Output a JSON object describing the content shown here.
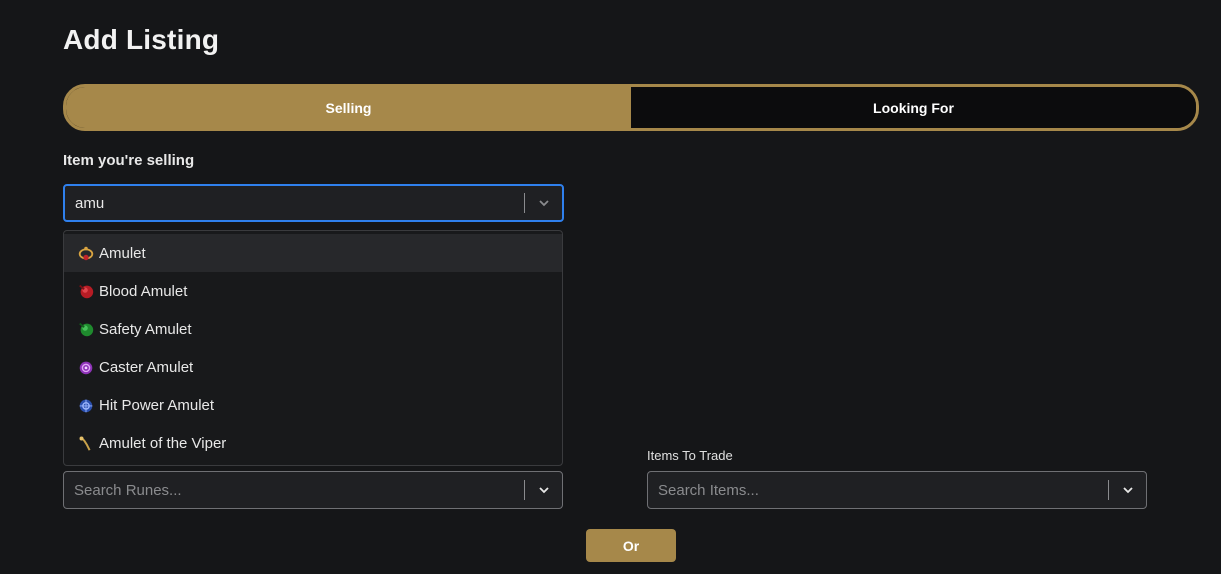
{
  "page": {
    "title": "Add Listing"
  },
  "mode_toggle": {
    "selling": "Selling",
    "looking_for": "Looking For",
    "active": "selling"
  },
  "item_selling": {
    "label": "Item you're selling",
    "value": "amu",
    "options": [
      {
        "label": "Amulet",
        "icon": "amulet-icon",
        "color": "#d9a441"
      },
      {
        "label": "Blood Amulet",
        "icon": "blood-amulet-icon",
        "color": "#c0232b"
      },
      {
        "label": "Safety Amulet",
        "icon": "safety-amulet-icon",
        "color": "#2e9b3a"
      },
      {
        "label": "Caster Amulet",
        "icon": "caster-amulet-icon",
        "color": "#a548c8"
      },
      {
        "label": "Hit Power Amulet",
        "icon": "hit-power-amulet-icon",
        "color": "#3560c4"
      },
      {
        "label": "Amulet of the Viper",
        "icon": "viper-amulet-icon",
        "color": "#c9a24a"
      }
    ]
  },
  "runes": {
    "placeholder": "Search Runes..."
  },
  "items_to_trade": {
    "label": "Items To Trade",
    "placeholder": "Search Items..."
  },
  "or_button": {
    "label": "Or"
  },
  "colors": {
    "accent": "#a6884a",
    "focus": "#2f80ed",
    "background": "#151618"
  }
}
